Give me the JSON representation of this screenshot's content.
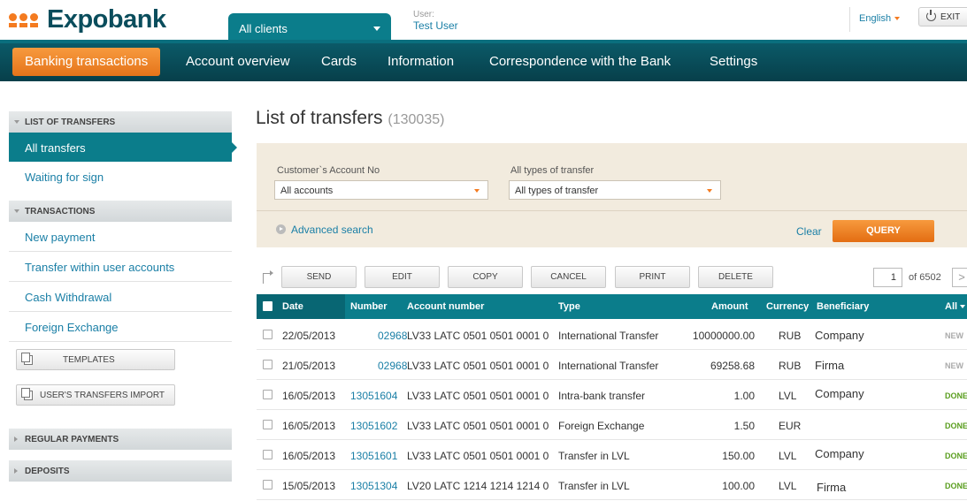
{
  "header": {
    "logo_text": "Expobank",
    "client_tab": "All clients",
    "user_label": "User:",
    "user_name": "Test User",
    "language": "English",
    "exit_label": "EXIT"
  },
  "nav": [
    {
      "label": "Banking transactions",
      "active": true
    },
    {
      "label": "Account overview"
    },
    {
      "label": "Cards"
    },
    {
      "label": "Information"
    },
    {
      "label": "Correspondence with the Bank"
    },
    {
      "label": "Settings"
    }
  ],
  "sidebar": {
    "list_of_transfers": "LIST OF TRANSFERS",
    "all_transfers": "All transfers",
    "waiting_for_sign": "Waiting for sign",
    "transactions": "TRANSACTIONS",
    "new_payment": "New payment",
    "transfer_within": "Transfer within user accounts",
    "cash_withdrawal": "Cash Withdrawal",
    "foreign_exchange": "Foreign Exchange",
    "templates": "TEMPLATES",
    "import": "USER'S TRANSFERS IMPORT",
    "regular_payments": "REGULAR PAYMENTS",
    "deposits": "DEPOSITS"
  },
  "main": {
    "title": "List of transfers",
    "count": "(130035)"
  },
  "filter": {
    "account_label": "Customer`s Account No",
    "account_value": "All accounts",
    "type_label": "All types of transfer",
    "type_value": "All types of transfer",
    "advanced": "Advanced search",
    "clear": "Clear",
    "query": "QUERY"
  },
  "toolbar": {
    "send": "SEND",
    "edit": "EDIT",
    "copy": "COPY",
    "cancel": "CANCEL",
    "print": "PRINT",
    "delete": "DELETE",
    "page": "1",
    "of": "of 6502",
    "next": ">"
  },
  "table": {
    "headers": {
      "date": "Date",
      "number": "Number",
      "account": "Account number",
      "type": "Type",
      "amount": "Amount",
      "currency": "Currency",
      "beneficiary": "Beneficiary",
      "status": "All"
    },
    "rows": [
      {
        "date": "22/05/2013",
        "number": "02968",
        "account": "LV33 LATC 0501 0501 0001 0",
        "type": "International Transfer",
        "amount": "10000000.00",
        "currency": "RUB",
        "beneficiary": "Company",
        "status": "NEW"
      },
      {
        "date": "21/05/2013",
        "number": "02968",
        "account": "LV33 LATC 0501 0501 0001 0",
        "type": "International Transfer",
        "amount": "69258.68",
        "currency": "RUB",
        "beneficiary": "Firma",
        "status": "NEW"
      },
      {
        "date": "16/05/2013",
        "number": "13051604",
        "account": "LV33 LATC 0501 0501 0001 0",
        "type": "Intra-bank transfer",
        "amount": "1.00",
        "currency": "LVL",
        "beneficiary": "Company",
        "status": "DONE"
      },
      {
        "date": "16/05/2013",
        "number": "13051602",
        "account": "LV33 LATC 0501 0501 0001 0",
        "type": "Foreign Exchange",
        "amount": "1.50",
        "currency": "EUR",
        "beneficiary": "",
        "status": "DONE"
      },
      {
        "date": "16/05/2013",
        "number": "13051601",
        "account": "LV33 LATC 0501 0501 0001 0",
        "type": "Transfer in LVL",
        "amount": "150.00",
        "currency": "LVL",
        "beneficiary": "Company",
        "status": "DONE"
      },
      {
        "date": "15/05/2013",
        "number": "13051304",
        "account": "LV20 LATC 1214 1214 1214 0",
        "type": "Transfer in LVL",
        "amount": "100.00",
        "currency": "LVL",
        "beneficiary": "Firma",
        "status": "DONE"
      }
    ]
  }
}
